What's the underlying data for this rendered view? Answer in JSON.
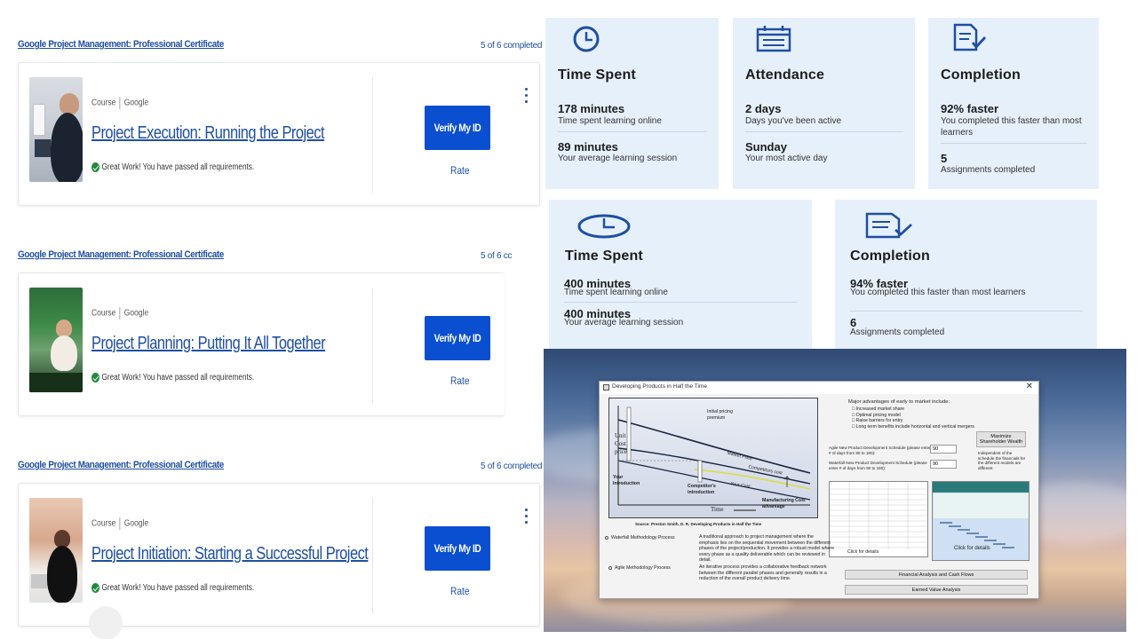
{
  "course_list": {
    "sections": [
      {
        "certificate_link": "Google Project Management: Professional Certificate",
        "progress": "5 of 6 completed",
        "course": {
          "type": "Course",
          "provider": "Google",
          "title": "Project Execution: Running the Project",
          "status": "Great Work! You have passed all requirements.",
          "verify_label": "Verify My ID",
          "rate_label": "Rate"
        }
      },
      {
        "certificate_link": "Google Project Management: Professional Certificate",
        "progress": "5 of 6 cc",
        "course": {
          "type": "Course",
          "provider": "Google",
          "title": "Project Planning: Putting It All Together",
          "status": "Great Work! You have passed all requirements.",
          "verify_label": "Verify My ID",
          "rate_label": "Rate"
        }
      },
      {
        "certificate_link": "Google Project Management: Professional Certificate",
        "progress": "5 of 6 completed",
        "course": {
          "type": "Course",
          "provider": "Google",
          "title": "Project Initiation: Starting a Successful Project",
          "status": "Great Work! You have passed all requirements.",
          "verify_label": "Verify My ID",
          "rate_label": "Rate"
        }
      }
    ]
  },
  "stats_top": {
    "time_spent": {
      "heading": "Time Spent",
      "value1": "178 minutes",
      "label1": "Time spent learning online",
      "value2": "89 minutes",
      "label2": "Your average learning session"
    },
    "attendance": {
      "heading": "Attendance",
      "value1": "2 days",
      "label1": "Days you've been active",
      "value2": "Sunday",
      "label2": "Your most active day"
    },
    "completion": {
      "heading": "Completion",
      "value1": "92% faster",
      "label1": "You completed this faster than most learners",
      "value2": "5",
      "label2": "Assignments completed"
    }
  },
  "stats_bottom": {
    "time_spent": {
      "heading": "Time Spent",
      "value1": "400 minutes",
      "label1": "Time spent learning online",
      "value2": "400 minutes",
      "label2": "Your average learning session"
    },
    "completion": {
      "heading": "Completion",
      "value1": "94% faster",
      "label1": "You completed this faster than most learners",
      "value2": "6",
      "label2": "Assignments completed"
    }
  },
  "app_window": {
    "title": "Developing Products in Half the Time",
    "graph": {
      "y_label_1": "Unit",
      "y_label_2": "Cost",
      "y_label_3": "price",
      "initial_pricing": "Initial pricing premium",
      "market_price": "Market Price",
      "competitors_cost": "Competitors cost",
      "your_cost": "Your Cost",
      "your_introduction": "Your Introduction",
      "competitor_introduction": "Competitor's introduction",
      "manufacturing_advantage": "Manufacturing Cost advantage",
      "time_label": "Time",
      "source": "Source: Preston Smith, D. R. Developing Products in Half the Time"
    },
    "advantages_heading": "Major advantages of early to market include:",
    "advantages": [
      "Increased market share",
      "Optimal pricing model",
      "Raise barriers for entry",
      "Long term benefits include horizontal and vertical mergers"
    ],
    "agile_schedule_label": "Agile New Product Development Schedule (please enter # of days from 90 to 180):",
    "agile_schedule_value": "90",
    "waterfall_schedule_label": "Waterfall New Product Development Schedule (please enter # of days from 90 to 180):",
    "waterfall_schedule_value": "90",
    "maximize_button": "Maximize Shareholder Wealth",
    "independent_note": "Independent of the schedule the financials for the different models are different",
    "waterfall_option": "Waterfall Methodology Process",
    "waterfall_desc": "A traditional approach to project management where the emphasis lies on the sequential movement between the different phases of the project/production. It provides a robust model where every phase as a quality deliverable which can be reviewed in detail.",
    "agile_option": "Agile Methodology Process",
    "agile_desc": "An iterative process provides a collaborative feedback network between the different parallel phases and generally results in a reduction of the overall product delivery time.",
    "click_details_1": "Click for details",
    "click_details_2": "Click for details",
    "financial_button": "Financial Analysis and Cash Flows",
    "earned_value_button": "Earned Value Analysis"
  }
}
